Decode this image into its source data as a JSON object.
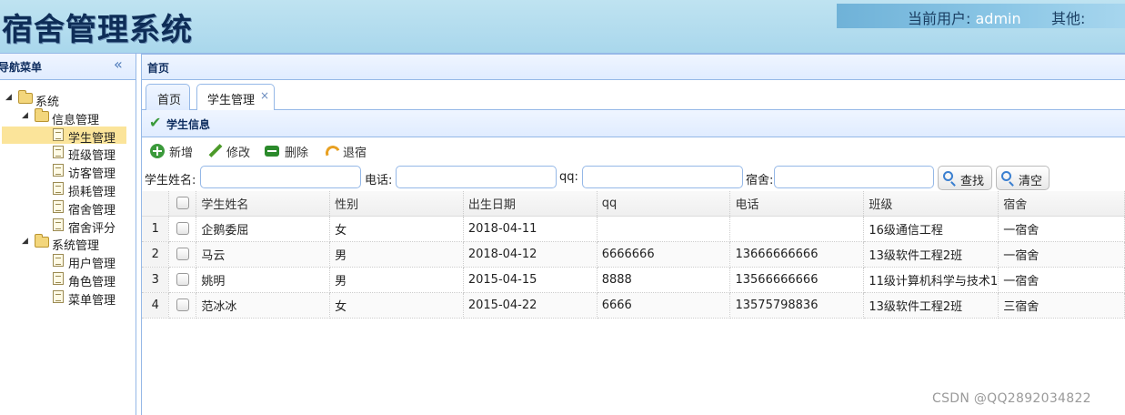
{
  "app": {
    "title": "宿舍管理系统"
  },
  "userbar": {
    "current_user_label": "当前用户:",
    "current_user": "admin",
    "other_label": "其他:"
  },
  "sidebar": {
    "title": "导航菜单",
    "collapse_icon": "double-chevron-left-icon",
    "tree": [
      {
        "label": "系统",
        "type": "folder"
      },
      {
        "label": "信息管理",
        "type": "folder"
      },
      {
        "label": "学生管理",
        "type": "file",
        "selected": true
      },
      {
        "label": "班级管理",
        "type": "file"
      },
      {
        "label": "访客管理",
        "type": "file"
      },
      {
        "label": "损耗管理",
        "type": "file"
      },
      {
        "label": "宿舍管理",
        "type": "file"
      },
      {
        "label": "宿舍评分",
        "type": "file"
      },
      {
        "label": "系统管理",
        "type": "folder"
      },
      {
        "label": "用户管理",
        "type": "file"
      },
      {
        "label": "角色管理",
        "type": "file"
      },
      {
        "label": "菜单管理",
        "type": "file"
      }
    ]
  },
  "main": {
    "title": "首页",
    "tabs": [
      {
        "label": "首页"
      },
      {
        "label": "学生管理",
        "close": "×"
      }
    ],
    "panel_title": "学生信息",
    "toolbar": {
      "add": "新增",
      "edit": "修改",
      "delete": "删除",
      "checkout": "退宿"
    },
    "search": {
      "name_label": "学生姓名:",
      "phone_label": "电话:",
      "qq_label": "qq:",
      "dorm_label": "宿舍:",
      "find_button": "查找",
      "clear_button": "清空"
    },
    "table": {
      "columns": [
        "学生姓名",
        "性别",
        "出生日期",
        "qq",
        "电话",
        "班级",
        "宿舍"
      ],
      "rows": [
        {
          "n": "1",
          "name": "企鹅委屈",
          "sex": "女",
          "birth": "2018-04-11",
          "qq": "",
          "phone": "",
          "class": "16级通信工程",
          "dorm": "一宿舍"
        },
        {
          "n": "2",
          "name": "马云",
          "sex": "男",
          "birth": "2018-04-12",
          "qq": "6666666",
          "phone": "13666666666",
          "class": "13级软件工程2班",
          "dorm": "一宿舍"
        },
        {
          "n": "3",
          "name": "姚明",
          "sex": "男",
          "birth": "2015-04-15",
          "qq": "8888",
          "phone": "13566666666",
          "class": "11级计算机科学与技术1",
          "dorm": "一宿舍"
        },
        {
          "n": "4",
          "name": "范冰冰",
          "sex": "女",
          "birth": "2015-04-22",
          "qq": "6666",
          "phone": "13575798836",
          "class": "13级软件工程2班",
          "dorm": "三宿舍"
        }
      ]
    }
  },
  "watermark": "CSDN @QQ2892034822"
}
